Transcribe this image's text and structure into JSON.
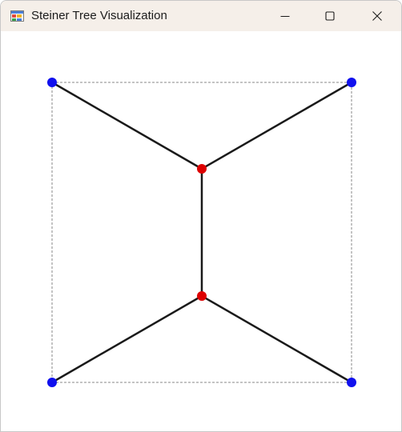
{
  "window": {
    "title": "Steiner Tree Visualization",
    "icon": "windows-forms-app-icon",
    "controls": [
      "minimize-icon",
      "maximize-icon",
      "close-icon"
    ]
  },
  "colors": {
    "titlebar_bg": "#f5efe9",
    "terminal": "#1010ee",
    "steiner": "#dd0000",
    "edge": "#1a1a1a",
    "bounding_box": "#8a8a8a",
    "canvas_bg": "#ffffff"
  },
  "graph": {
    "terminals": [
      {
        "id": "t1"
      },
      {
        "id": "t2"
      },
      {
        "id": "t3"
      },
      {
        "id": "t4"
      }
    ],
    "steiner_points": [
      {
        "id": "s1"
      },
      {
        "id": "s2"
      }
    ],
    "edges": [
      [
        "t1",
        "s1"
      ],
      [
        "t2",
        "s1"
      ],
      [
        "s1",
        "s2"
      ],
      [
        "t3",
        "s2"
      ],
      [
        "t4",
        "s2"
      ]
    ],
    "bounding_box": true
  }
}
